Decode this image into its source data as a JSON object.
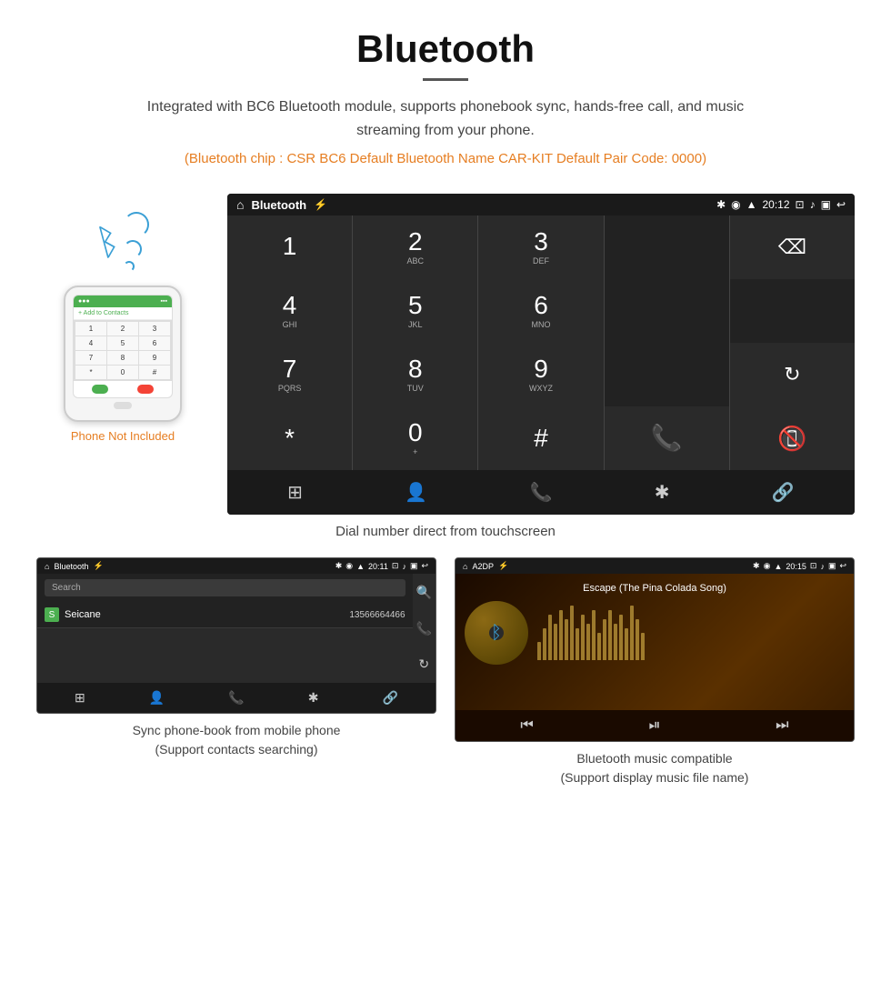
{
  "page": {
    "title": "Bluetooth",
    "subtitle": "Integrated with BC6 Bluetooth module, supports phonebook sync, hands-free call, and music streaming from your phone.",
    "specs": "(Bluetooth chip : CSR BC6    Default Bluetooth Name CAR-KIT    Default Pair Code: 0000)"
  },
  "carScreen": {
    "statusBar": {
      "title": "Bluetooth",
      "time": "20:12"
    },
    "dialpad": {
      "keys": [
        {
          "num": "1",
          "letters": ""
        },
        {
          "num": "2",
          "letters": "ABC"
        },
        {
          "num": "3",
          "letters": "DEF"
        },
        {
          "num": "",
          "letters": ""
        },
        {
          "num": "⌫",
          "letters": ""
        },
        {
          "num": "4",
          "letters": "GHI"
        },
        {
          "num": "5",
          "letters": "JKL"
        },
        {
          "num": "6",
          "letters": "MNO"
        },
        {
          "num": "",
          "letters": ""
        },
        {
          "num": "",
          "letters": ""
        },
        {
          "num": "7",
          "letters": "PQRS"
        },
        {
          "num": "8",
          "letters": "TUV"
        },
        {
          "num": "9",
          "letters": "WXYZ"
        },
        {
          "num": "",
          "letters": ""
        },
        {
          "num": "↻",
          "letters": ""
        },
        {
          "num": "*",
          "letters": ""
        },
        {
          "num": "0",
          "letters": "+"
        },
        {
          "num": "#",
          "letters": ""
        },
        {
          "num": "📞",
          "letters": ""
        },
        {
          "num": "📵",
          "letters": ""
        }
      ]
    },
    "caption": "Dial number direct from touchscreen",
    "navIcons": [
      "⊞",
      "👤",
      "📞",
      "✱",
      "🔗"
    ]
  },
  "phonebook": {
    "statusBar": {
      "title": "Bluetooth",
      "time": "20:11"
    },
    "searchPlaceholder": "Search",
    "contacts": [
      {
        "initial": "S",
        "name": "Seicane",
        "number": "13566664466"
      }
    ],
    "caption": "Sync phone-book from mobile phone\n(Support contacts searching)",
    "navIcons": [
      "⊞",
      "👤",
      "📞",
      "✱",
      "🔗"
    ],
    "sideIcons": [
      "🔍",
      "📞",
      "↻"
    ]
  },
  "music": {
    "statusBar": {
      "title": "A2DP",
      "time": "20:15"
    },
    "songTitle": "Escape (The Pina Colada Song)",
    "caption": "Bluetooth music compatible\n(Support display music file name)",
    "controls": [
      "⏮",
      "⏯",
      "⏭"
    ],
    "waveBars": [
      20,
      35,
      50,
      40,
      55,
      45,
      60,
      35,
      50,
      40,
      55,
      30,
      45,
      55,
      40,
      50,
      35,
      60,
      45,
      30
    ]
  },
  "phone": {
    "notIncluded": "Phone Not Included",
    "keys": [
      "1",
      "2",
      "3",
      "4",
      "5",
      "6",
      "7",
      "8",
      "9",
      "*",
      "0",
      "#"
    ]
  }
}
